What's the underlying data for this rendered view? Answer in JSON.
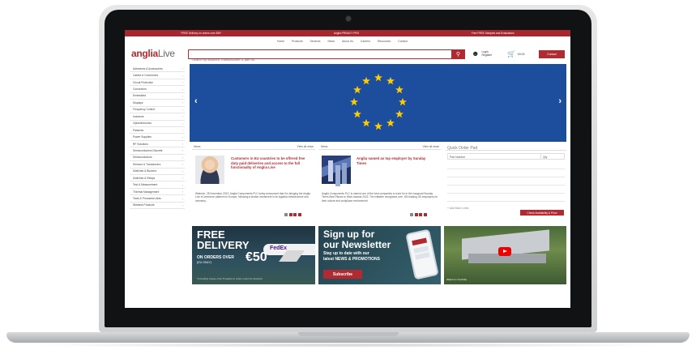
{
  "topbar": {
    "items": [
      "FREE Delivery on orders over £50*",
      "Anglia PRIVACY PRO",
      "Free FREE Samples and Evaluations"
    ]
  },
  "header": {
    "logo_main": "anglia",
    "logo_live": "Live",
    "nav": [
      "Home",
      "Products",
      "Services",
      "News",
      "About Us",
      "Careers",
      "Resources",
      "Contact"
    ],
    "search_placeholder": "Search by keyword, manufacturer & part no.",
    "account": [
      "Login",
      "Register"
    ],
    "cart": "£0.00",
    "contact_label": "Contact"
  },
  "sidebar": {
    "items": [
      "Adhesives & Accessories",
      "Cables & Connectors",
      "Circuit Protection",
      "Connectors",
      "Embedded",
      "Displays",
      "Frequency Control",
      "Inductors",
      "Optoelectronics",
      "Passives",
      "Power Supplies",
      "RF Solutions",
      "Semiconductors Discrete",
      "Semiconductors",
      "Sensors & Transducers",
      "Switches & Buzzers",
      "Switches & Relays",
      "Test & Measurement",
      "Thermal Management",
      "Tools & Production Aids",
      "Wireless Products"
    ]
  },
  "news": [
    {
      "label": "News",
      "more": "View all news",
      "title": "Customers in EU countries to be offered free duty paid deliveries and access to the full functionality of Anglia Live",
      "body": "Wisbech, 28 November 2022: Anglia Components PLC today announced that it is bringing the Anglia Live eCommerce platform to Europe, following a similar investment in its logistics infrastructure and inventory."
    },
    {
      "label": "News",
      "more": "View all news",
      "title": "Anglia named as top employer by Sunday Times",
      "body": "Anglia Components PLC is named one of the best companies to work for in the inaugural Sunday Times Best Places to Work Awards 2022. The initiative recognises over 150 leading UK employers for their culture and workplace environment."
    }
  ],
  "quick_order": {
    "title": "Quick Order Pad",
    "col_part": "Part Number",
    "col_qty": "Qty",
    "link": "+ Add More Lines",
    "button": "Check Availability & Price"
  },
  "promos": {
    "free_delivery": {
      "line1": "FREE",
      "line2": "DELIVERY",
      "line3": "ON ORDERS OVER",
      "amount": "€50",
      "note": "(EU ONLY)",
      "foot": "*A handling charge of £4.75 applies to orders under the threshold",
      "carrier": "FedEx"
    },
    "newsletter": {
      "line1": "Sign up for",
      "line2": "our Newsletter",
      "sub1": "Stay up to date with our",
      "sub2": "latest NEWS & PROMOTIONS",
      "button": "Subscribe"
    },
    "video": {
      "caption": "Watch on YouTube"
    }
  },
  "colors": {
    "brand": "#b22a31",
    "banner": "#1d4e9e",
    "star": "#ffcc00"
  }
}
